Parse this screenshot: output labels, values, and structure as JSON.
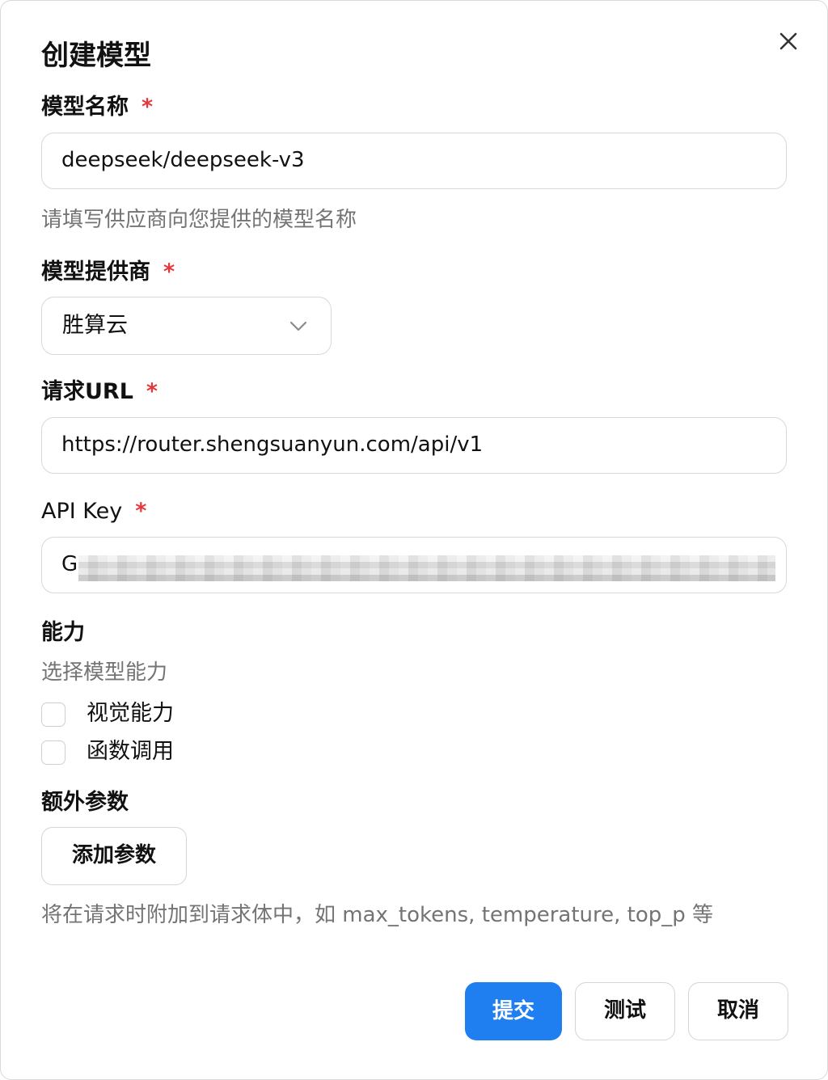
{
  "dialog": {
    "title": "创建模型",
    "close_icon": "close-icon"
  },
  "model_name": {
    "label": "模型名称",
    "required_mark": "*",
    "value": "deepseek/deepseek-v3",
    "hint": "请填写供应商向您提供的模型名称"
  },
  "provider": {
    "label": "模型提供商",
    "required_mark": "*",
    "selected": "胜算云",
    "icon": "chevron-down-icon"
  },
  "request_url": {
    "label": "请求URL",
    "required_mark": "*",
    "value": "https://router.shengsuanyun.com/api/v1"
  },
  "api_key": {
    "label": "API Key",
    "required_mark": "*",
    "visible_prefix": "G"
  },
  "capabilities": {
    "label": "能力",
    "hint": "选择模型能力",
    "options": [
      {
        "label": "视觉能力",
        "checked": false
      },
      {
        "label": "函数调用",
        "checked": false
      }
    ]
  },
  "extra_params": {
    "label": "额外参数",
    "add_button": "添加参数",
    "hint": "将在请求时附加到请求体中，如 max_tokens, temperature, top_p 等"
  },
  "footer": {
    "submit": "提交",
    "test": "测试",
    "cancel": "取消",
    "primary_color": "#1f7ff0"
  }
}
